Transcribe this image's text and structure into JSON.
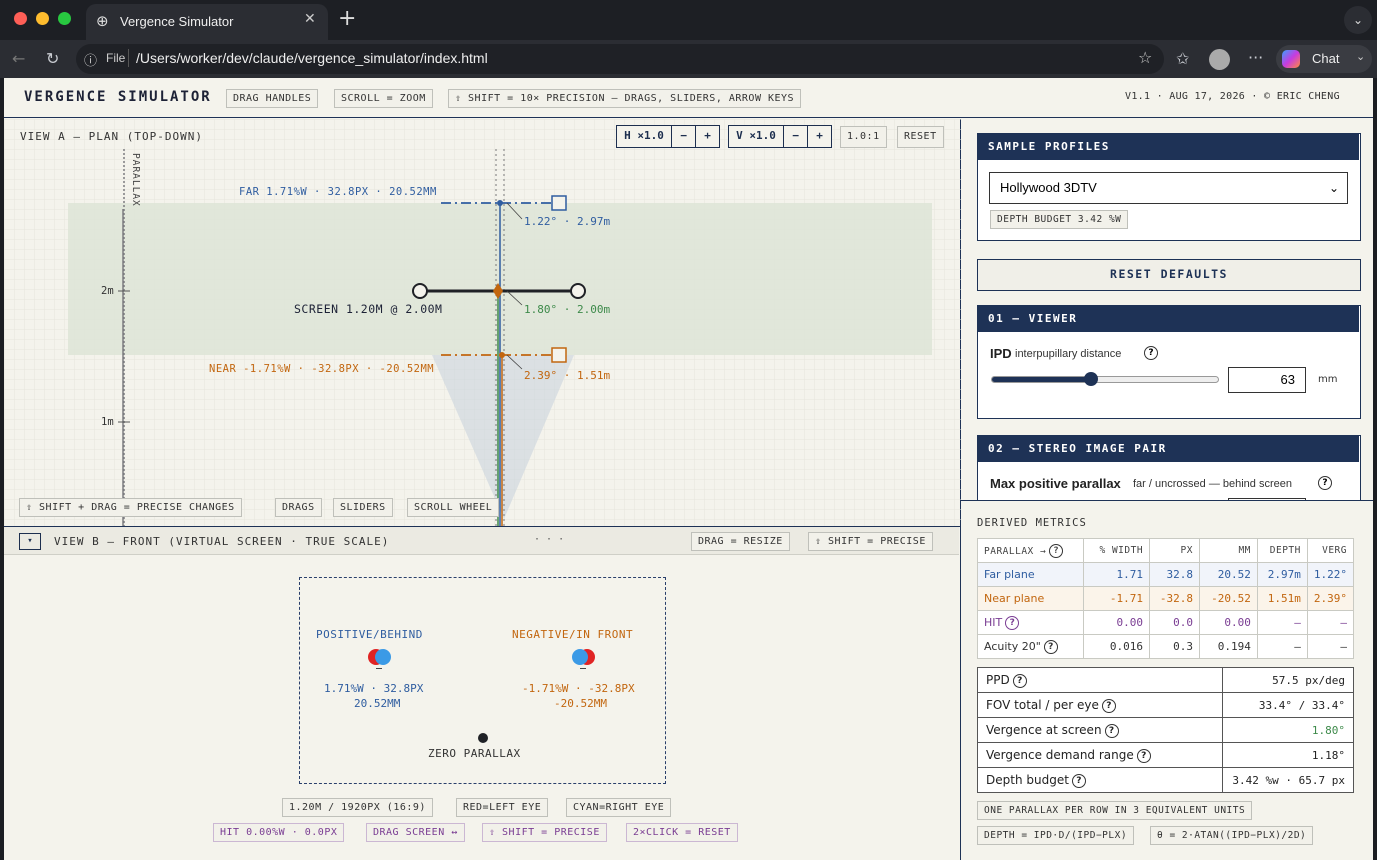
{
  "browser": {
    "tab_title": "Vergence Simulator",
    "url_scheme": "File",
    "url": "/Users/worker/dev/claude/vergence_simulator/index.html",
    "chat_label": "Chat"
  },
  "header": {
    "title": "VERGENCE SIMULATOR",
    "hints": [
      "DRAG HANDLES",
      "SCROLL = ZOOM",
      "⇧ SHIFT = 10× PRECISION — DRAGS, SLIDERS, ARROW KEYS"
    ],
    "version": "V1.1 · AUG 17, 2026 · © ERIC CHENG"
  },
  "view_a": {
    "title": "VIEW A — PLAN (TOP-DOWN)",
    "h_zoom": "H ×1.0",
    "v_zoom": "V ×1.0",
    "minus": "−",
    "plus": "+",
    "ratio": "1.0:1",
    "reset": "RESET",
    "parallax_axis": "PARALLAX",
    "far_label": "FAR 1.71%W · 32.8PX · 20.52MM",
    "far_readout": "1.22° · 2.97m",
    "screen_label": "SCREEN 1.20M @ 2.00M",
    "screen_readout": "1.80° · 2.00m",
    "near_label": "NEAR -1.71%W · -32.8PX · -20.52MM",
    "near_readout": "2.39° · 1.51m",
    "tick_2m": "2m",
    "tick_1m": "1m",
    "footer_tags": [
      "⇧ SHIFT + DRAG = PRECISE CHANGES",
      "DRAGS",
      "SLIDERS",
      "SCROLL WHEEL"
    ]
  },
  "view_b": {
    "toggle": "▾",
    "title": "VIEW B — FRONT (VIRTUAL SCREEN · TRUE SCALE)",
    "dots": "· · ·",
    "drag_hint": "DRAG = RESIZE",
    "shift_hint": "⇧ SHIFT = PRECISE",
    "positive_title": "POSITIVE/BEHIND",
    "positive_line1": "1.71%W · 32.8PX",
    "positive_line2": "20.52MM",
    "negative_title": "NEGATIVE/IN FRONT",
    "negative_line1": "-1.71%W · -32.8PX",
    "negative_line2": "-20.52MM",
    "zero_label": "ZERO PARALLAX",
    "info_tags": [
      "1.20M / 1920PX (16:9)",
      "RED=LEFT EYE",
      "CYAN=RIGHT EYE"
    ],
    "hit_tags": [
      "HIT 0.00%W · 0.0PX",
      "DRAG SCREEN ↔",
      "⇧ SHIFT = PRECISE",
      "2×CLICK = RESET"
    ]
  },
  "sidebar": {
    "profiles": {
      "title": "SAMPLE PROFILES",
      "selected": "Hollywood 3DTV",
      "budget": "DEPTH BUDGET 3.42 %W"
    },
    "reset_defaults": "RESET DEFAULTS",
    "viewer": {
      "title": "01 — VIEWER",
      "ipd_label": "IPD",
      "ipd_sub": "interpupillary distance",
      "ipd_value": "63",
      "ipd_unit": "mm",
      "ipd_fraction": 0.44
    },
    "stereo": {
      "title": "02 — STEREO IMAGE PAIR",
      "max_pos_label": "Max positive parallax",
      "max_pos_sub": "far / uncrossed — behind screen"
    }
  },
  "derived": {
    "title": "DERIVED METRICS",
    "columns": [
      "PARALLAX →",
      "% WIDTH",
      "PX",
      "MM",
      "DEPTH",
      "VERG"
    ],
    "rows": [
      {
        "label": "Far plane",
        "w": "1.71",
        "px": "32.8",
        "mm": "20.52",
        "depth": "2.97m",
        "verg": "1.22°"
      },
      {
        "label": "Near plane",
        "w": "-1.71",
        "px": "-32.8",
        "mm": "-20.52",
        "depth": "1.51m",
        "verg": "2.39°"
      },
      {
        "label": "HIT",
        "w": "0.00",
        "px": "0.0",
        "mm": "0.00",
        "depth": "–",
        "verg": "–"
      },
      {
        "label": "Acuity 20\"",
        "w": "0.016",
        "px": "0.3",
        "mm": "0.194",
        "depth": "–",
        "verg": "–"
      }
    ],
    "stats": [
      {
        "label": "PPD",
        "value": "57.5 px/deg"
      },
      {
        "label": "FOV total / per eye",
        "value": "33.4° / 33.4°"
      },
      {
        "label": "Vergence at screen",
        "value": "1.80°"
      },
      {
        "label": "Vergence demand range",
        "value": "1.18°"
      },
      {
        "label": "Depth budget",
        "value": "3.42 %w · 65.7 px"
      }
    ],
    "notes": [
      "ONE PARALLAX PER ROW IN 3 EQUIVALENT UNITS",
      "DEPTH = IPD·D/(IPD−PLX)",
      "θ = 2·ATAN((IPD−PLX)/2D)"
    ]
  },
  "colors": {
    "navy": "#1e3256",
    "far": "#2f5da0",
    "near": "#c2660f",
    "screen_green": "#3d8a4a",
    "hit": "#7a3d93"
  }
}
